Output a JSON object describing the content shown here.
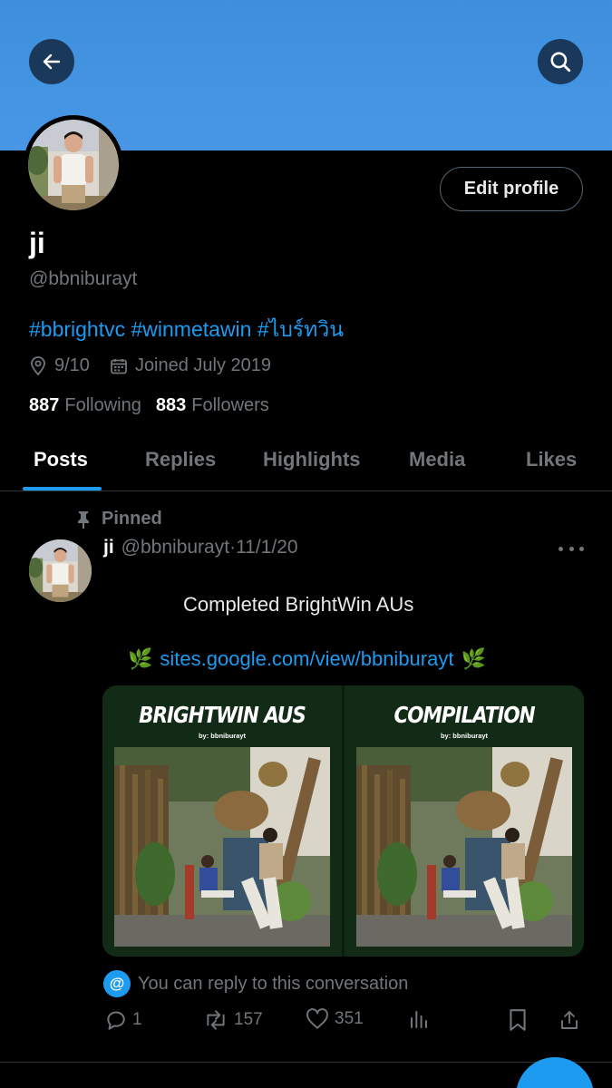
{
  "profile": {
    "display_name": "ji",
    "handle": "@bbniburayt",
    "bio": "#bbrightvc #winmetawin #ไบร์ทวิน",
    "location": "9/10",
    "joined": "Joined July 2019",
    "following_count": "887",
    "following_label": "Following",
    "followers_count": "883",
    "followers_label": "Followers",
    "edit_label": "Edit profile"
  },
  "header": {
    "back_icon": "arrow-left-icon",
    "search_icon": "search-icon",
    "banner_color": "#4593e0"
  },
  "tabs": [
    {
      "label": "Posts",
      "active": true
    },
    {
      "label": "Replies",
      "active": false
    },
    {
      "label": "Highlights",
      "active": false
    },
    {
      "label": "Media",
      "active": false
    },
    {
      "label": "Likes",
      "active": false
    }
  ],
  "tweet": {
    "pinned_label": "Pinned",
    "author_name": "ji",
    "author_handle": "@bbniburayt",
    "separator": "·",
    "date": "11/1/20",
    "text": "Completed BrightWin AUs",
    "link_emoji": "🌿",
    "link": "sites.google.com/view/bbniburayt",
    "media": [
      {
        "title": "BRIGHTWIN AUS",
        "byline": "by: bbniburayt"
      },
      {
        "title": "COMPILATION",
        "byline": "by: bbniburayt"
      }
    ],
    "reply_note": "You can reply to this conversation",
    "reply_note_badge": "@",
    "replies": "1",
    "reposts": "157",
    "likes": "351"
  },
  "colors": {
    "accent": "#1d9bf0",
    "muted": "#71767b",
    "background": "#000000",
    "card_green": "#122b16"
  }
}
